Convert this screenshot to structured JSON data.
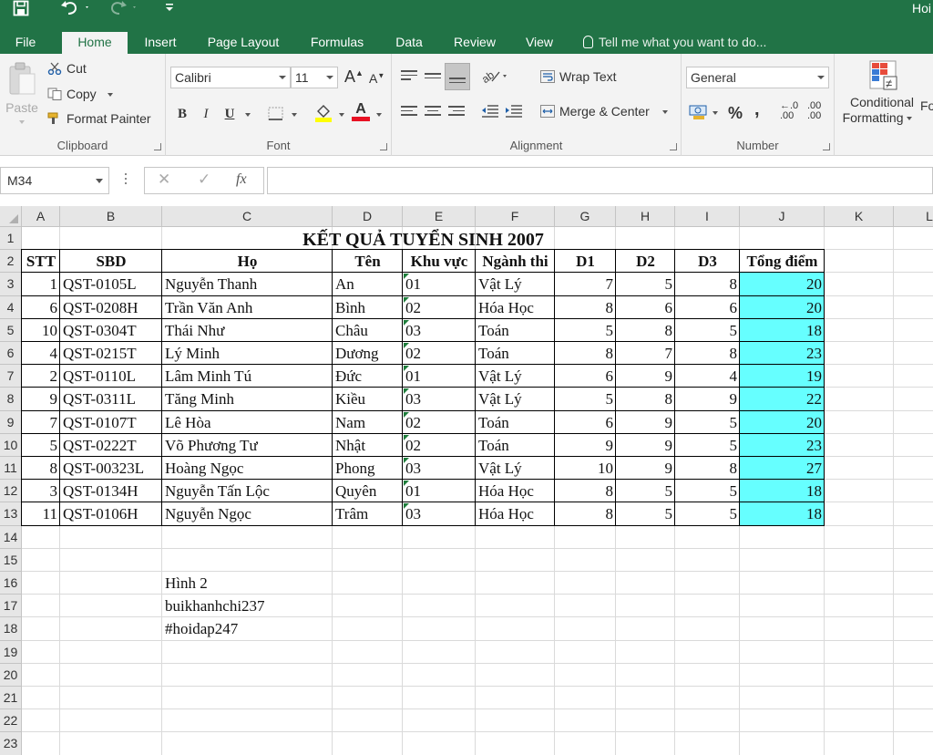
{
  "titlebar": {
    "app_title": "Hoi"
  },
  "tabs": [
    "File",
    "Home",
    "Insert",
    "Page Layout",
    "Formulas",
    "Data",
    "Review",
    "View"
  ],
  "tell_me": "Tell me what you want to do...",
  "clipboard": {
    "paste": "Paste",
    "cut": "Cut",
    "copy": "Copy",
    "format_painter": "Format Painter",
    "label": "Clipboard"
  },
  "font": {
    "name": "Calibri",
    "size": "11",
    "bold": "B",
    "italic": "I",
    "underline": "U",
    "grow": "A",
    "shrink": "A",
    "color_letter": "A",
    "label": "Font"
  },
  "alignment": {
    "wrap_text": "Wrap Text",
    "merge_center": "Merge & Center",
    "label": "Alignment"
  },
  "number": {
    "format": "General",
    "percent": "%",
    "comma": ",",
    "inc_dec": ".00",
    "dec_dec": ".00",
    "inc_top": "←.0",
    "dec_top": ".00",
    "label": "Number"
  },
  "styles": {
    "conditional": "Conditional",
    "formatting": "Formatting",
    "cut_label": "Fo"
  },
  "formula_bar": {
    "name_box": "M34",
    "fx": "fx",
    "cancel": "✕",
    "enter": "✓",
    "formula": ""
  },
  "columns": [
    "A",
    "B",
    "C",
    "D",
    "E",
    "F",
    "G",
    "H",
    "I",
    "J",
    "K",
    "L"
  ],
  "rows": [
    "1",
    "2",
    "3",
    "4",
    "5",
    "6",
    "7",
    "8",
    "9",
    "10",
    "11",
    "12",
    "13",
    "14",
    "15",
    "16",
    "17",
    "18",
    "19",
    "20",
    "21",
    "22",
    "23"
  ],
  "sheet": {
    "title": "KẾT QUẢ TUYỂN SINH 2007",
    "headers": [
      "STT",
      "SBD",
      "Họ",
      "Tên",
      "Khu vực",
      "Ngành thi",
      "D1",
      "D2",
      "D3",
      "Tổng điểm"
    ],
    "rows": [
      [
        "1",
        "QST-0105L",
        "Nguyễn Thanh",
        "An",
        "01",
        "Vật Lý",
        "7",
        "5",
        "8",
        "20"
      ],
      [
        "6",
        "QST-0208H",
        "Trần Văn Anh",
        "Bình",
        "02",
        "Hóa Học",
        "8",
        "6",
        "6",
        "20"
      ],
      [
        "10",
        "QST-0304T",
        "Thái Như",
        "Châu",
        "03",
        "Toán",
        "5",
        "8",
        "5",
        "18"
      ],
      [
        "4",
        "QST-0215T",
        "Lý Minh",
        "Dương",
        "02",
        "Toán",
        "8",
        "7",
        "8",
        "23"
      ],
      [
        "2",
        "QST-0110L",
        "Lâm Minh Tú",
        "Đức",
        "01",
        "Vật Lý",
        "6",
        "9",
        "4",
        "19"
      ],
      [
        "9",
        "QST-0311L",
        "Tăng Minh",
        "Kiều",
        "03",
        "Vật Lý",
        "5",
        "8",
        "9",
        "22"
      ],
      [
        "7",
        "QST-0107T",
        "Lê Hòa",
        "Nam",
        "02",
        "Toán",
        "6",
        "9",
        "5",
        "20"
      ],
      [
        "5",
        "QST-0222T",
        "Võ Phương Tư",
        "Nhật",
        "02",
        "Toán",
        "9",
        "9",
        "5",
        "23"
      ],
      [
        "8",
        "QST-00323L",
        "Hoàng Ngọc",
        "Phong",
        "03",
        "Vật Lý",
        "10",
        "9",
        "8",
        "27"
      ],
      [
        "3",
        "QST-0134H",
        "Nguyễn Tấn Lộc",
        "Quyên",
        "01",
        "Hóa Học",
        "8",
        "5",
        "5",
        "18"
      ],
      [
        "11",
        "QST-0106H",
        "Nguyễn Ngọc",
        "Trâm",
        "03",
        "Hóa Học",
        "8",
        "5",
        "5",
        "18"
      ]
    ],
    "notes": [
      "Hình 2",
      "buikhanhchi237",
      "#hoidap247"
    ]
  },
  "colors": {
    "excel_green": "#217346",
    "total_fill": "#66ffff"
  }
}
